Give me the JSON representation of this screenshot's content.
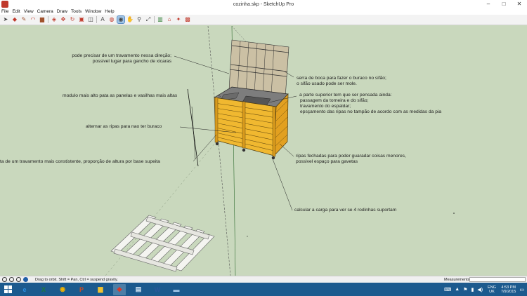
{
  "window": {
    "title": "cozinha.skp - SketchUp Pro"
  },
  "menu": [
    "File",
    "Edit",
    "View",
    "Camera",
    "Draw",
    "Tools",
    "Window",
    "Help"
  ],
  "toolbar": {
    "icons": [
      "select-arrow-icon",
      "eraser-icon",
      "pencil-icon",
      "arc-icon",
      "rectangle-icon",
      "push-pull-icon",
      "move-icon",
      "rotate-icon",
      "offset-icon",
      "tape-measure-icon",
      "text-icon",
      "paint-bucket-icon",
      "orbit-icon",
      "pan-icon",
      "zoom-icon",
      "zoom-extents-icon",
      "components-icon",
      "warehouse-icon",
      "extension-icon",
      "layout-icon"
    ]
  },
  "annotations": {
    "a1_line1": "pode precisar de um travamento nessa direção;",
    "a1_line2": "possivel lugar para gancho de xicaras",
    "a2": "modulo mais alto pata as panelas e vasilhas mais altas",
    "a3": "alternar as ripas para nao ter buraco",
    "a4": "ta de um travamento mais constistente, proporção de altura por base supeita",
    "a5_line1": "serra de boca para fazer o buraco no sifão;",
    "a5_line2": "o sifão usado pode ser mole.",
    "a6_line1": "a parte superior tem que ser pensada ainda:",
    "a6_line2": "passagem da torneira e do sifão;",
    "a6_line3": "travamento do espaldar;",
    "a6_line4": "epsçamento das ripas no tampão de acordo com as medidas da pia",
    "a7_line1": "ripas fechadas para poder guaradar coisas menores,",
    "a7_line2": "possivel espaço para gavetas",
    "a8": "calcular a carga para ver se 4 rodinhas suportam"
  },
  "status": {
    "hint": "Drag to orbit. Shift = Pan, Ctrl = suspend gravity.",
    "measurements_label": "Measurements",
    "measurements_value": ""
  },
  "taskbar": {
    "apps": [
      {
        "name": "ie-icon",
        "glyph": "e",
        "color": "#2b8fe0",
        "active": false
      },
      {
        "name": "excel-icon",
        "glyph": "X",
        "color": "#1e7a3c",
        "active": false
      },
      {
        "name": "chrome-icon",
        "glyph": "◉",
        "color": "#f4b400",
        "active": false
      },
      {
        "name": "powerpoint-icon",
        "glyph": "P",
        "color": "#d04a1f",
        "active": false
      },
      {
        "name": "explorer-icon",
        "glyph": "▆",
        "color": "#f1c232",
        "active": false
      },
      {
        "name": "sketchup-icon",
        "glyph": "◆",
        "color": "#d83a2b",
        "active": true
      },
      {
        "name": "notepad-icon",
        "glyph": "▤",
        "color": "#cfe2f3",
        "active": false
      },
      {
        "name": "word-icon",
        "glyph": "W",
        "color": "#2b579a",
        "active": false
      },
      {
        "name": "photos-icon",
        "glyph": "▬",
        "color": "#9fc5e8",
        "active": false
      }
    ],
    "lang_top": "ENG",
    "lang_bottom": "UK",
    "time": "4:53 PM",
    "date": "7/9/2015"
  }
}
